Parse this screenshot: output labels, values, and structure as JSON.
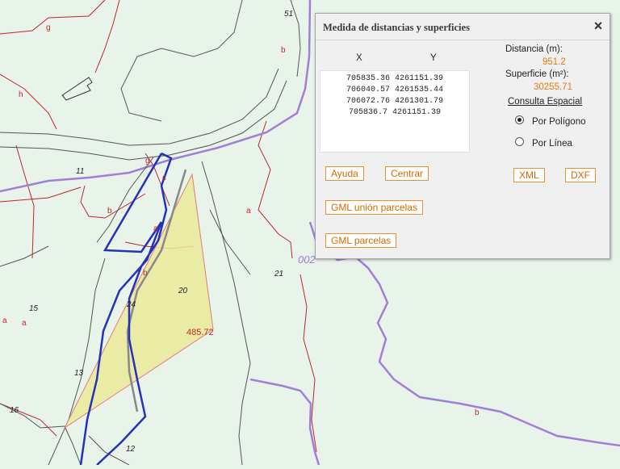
{
  "panel": {
    "title": "Medida de distancias y superficies",
    "close_icon": "close-icon",
    "col_x": "X",
    "col_y": "Y",
    "coordinates": [
      "705835.36 4261151.39",
      "706040.57 4261535.44",
      "706072.76 4261301.79",
      "705836.7 4261151.39"
    ],
    "distance_label": "Distancia (m):",
    "distance_value": "951.2",
    "surface_label": "Superficie (m²):",
    "surface_value": "30255.71",
    "spatial_title": "Consulta Espacial",
    "options": [
      {
        "label": "Por Polígono",
        "selected": true
      },
      {
        "label": "Por Línea",
        "selected": false
      }
    ],
    "buttons": {
      "help": "Ayuda",
      "center": "Centrar",
      "xml": "XML",
      "dxf": "DXF",
      "gml_union": "GML unión parcelas",
      "gml_parcels": "GML parcelas"
    }
  },
  "map": {
    "parcel_numbers": [
      "11",
      "15",
      "13",
      "16",
      "12",
      "21",
      "20",
      "24",
      "51"
    ],
    "subparcel_letters": [
      "g",
      "h",
      "b",
      "a",
      "c",
      "b",
      "a",
      "g",
      "b",
      "a",
      "b",
      "a"
    ],
    "polygon_id": "002",
    "measurement_label": "485.72",
    "colors": {
      "background": "#e8f3ea",
      "parcel_border": "#c0262b",
      "road_border": "#a07fd6",
      "measure_polygon": "#2531b8",
      "selected_area": "#eaea9a",
      "accent": "#e07c12"
    }
  }
}
